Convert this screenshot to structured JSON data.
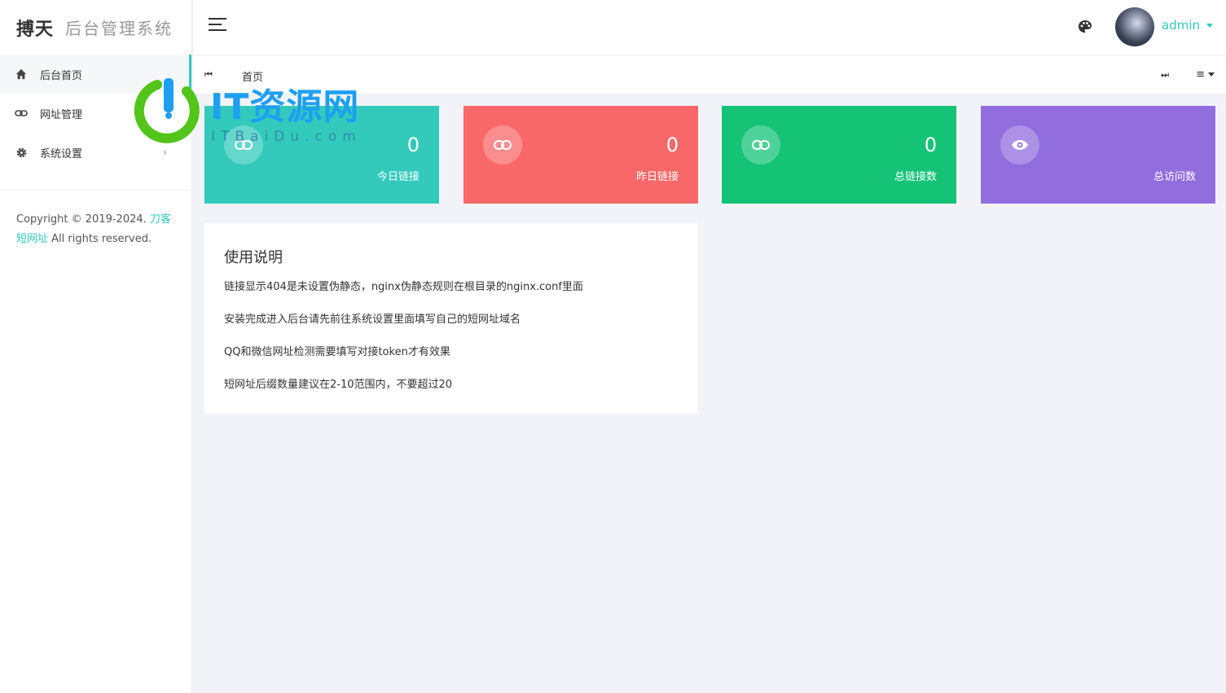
{
  "brand": {
    "strong": "搏天",
    "light": "后台管理系统"
  },
  "sidebar": {
    "items": [
      {
        "label": "后台首页",
        "icon": "home-icon",
        "active": true
      },
      {
        "label": "网址管理",
        "icon": "link-icon",
        "active": false
      },
      {
        "label": "系统设置",
        "icon": "gear-icon",
        "active": false,
        "arrow": "›"
      }
    ],
    "copyright": {
      "prefix": "Copyright © 2019-2024. ",
      "link": "刀客短网址",
      "suffix": " All rights reserved."
    }
  },
  "header": {
    "user": "admin",
    "palette_icon": "palette-icon",
    "avatar": "avatar"
  },
  "tabs": {
    "prev_icon": "⏮",
    "home": "首页",
    "next_icon": "⏭",
    "menu_icon": "≡"
  },
  "cards": [
    {
      "value": "0",
      "label": "今日链接",
      "color": "#33cabb",
      "icon": "link-icon"
    },
    {
      "value": "0",
      "label": "昨日链接",
      "color": "#f96868",
      "icon": "link-icon"
    },
    {
      "value": "0",
      "label": "总链接数",
      "color": "#15c377",
      "icon": "link-icon"
    },
    {
      "value": "",
      "label": "总访问数",
      "color": "#926dde",
      "icon": "eye-icon"
    }
  ],
  "notice": {
    "title": "使用说明",
    "lines": [
      "链接显示404是未设置伪静态，nginx伪静态规则在根目录的nginx.conf里面",
      "安装完成进入后台请先前往系统设置里面填写自己的短网址域名",
      "QQ和微信网址检测需要填写对接token才有效果",
      "短网址后缀数量建议在2-10范围内，不要超过20"
    ]
  },
  "watermark": {
    "text": "IT资源网",
    "sub": "ITBaiDu.com"
  },
  "colors": {
    "accent": "#33cabb"
  }
}
